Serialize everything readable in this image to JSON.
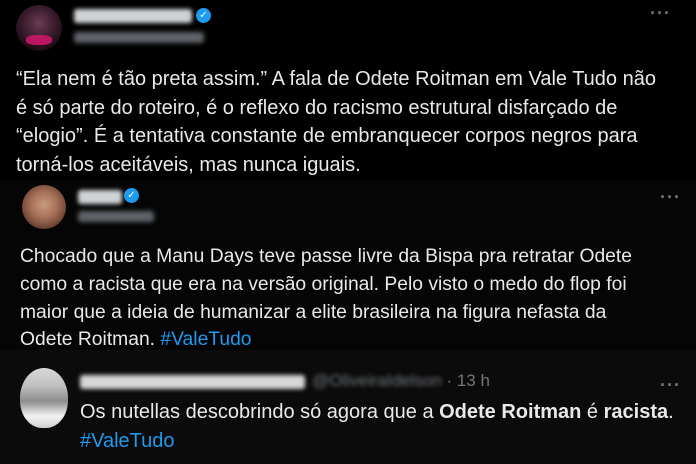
{
  "colors": {
    "background": "#000000",
    "text": "#e7e9ea",
    "muted": "#71767b",
    "link": "#1d9bf0",
    "verified": "#1d9bf0"
  },
  "tweets": [
    {
      "verified_icon": "verified-badge-icon",
      "more_icon": "more-horizontal-icon",
      "lines": [
        "“Ela nem é tão preta assim.” A fala de Odete Roitman em Vale Tudo não",
        "é só parte do roteiro, é o reflexo do racismo estrutural disfarçado de",
        "“elogio”. É a tentativa constante de embranquecer corpos negros para",
        "torná-los aceitáveis, mas nunca iguais."
      ]
    },
    {
      "verified_icon": "verified-badge-icon",
      "more_icon": "more-horizontal-icon",
      "lines": [
        "Chocado que a Manu Days teve passe livre da Bispa pra retratar Odete",
        "como a racista que era na versão original. Pelo visto o medo do flop foi",
        "maior que a ideia de humanizar a elite brasileira na figura nefasta da"
      ],
      "last_line_text": "Odete Roitman. ",
      "hashtag": "#ValeTudo"
    },
    {
      "handle": "@OliveiraIdelson",
      "separator": "·",
      "time": "13 h",
      "more_icon": "more-horizontal-icon",
      "text_before": "Os nutellas descobrindo só agora que a ",
      "bold_1": "Odete Roitman",
      "text_mid": " é ",
      "bold_2": "racista",
      "text_after": ".",
      "hashtag": "#ValeTudo"
    }
  ]
}
